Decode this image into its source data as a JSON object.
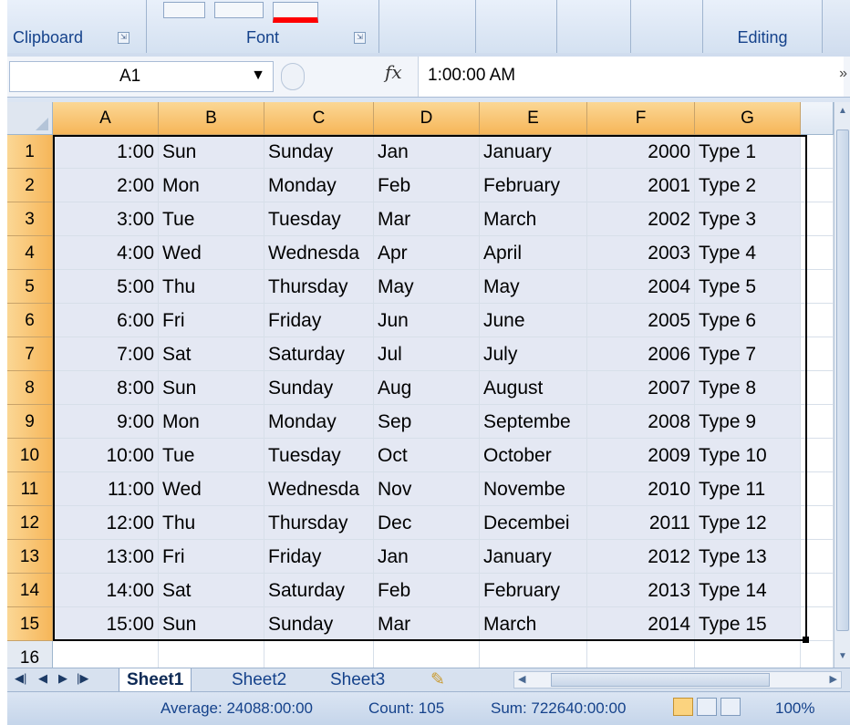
{
  "ribbon": {
    "groups": [
      {
        "label": "Clipboard",
        "launcher": "⇲"
      },
      {
        "label": "Font",
        "launcher": "⇲"
      },
      {
        "label": "Editing"
      }
    ]
  },
  "formula_bar": {
    "name_box": "A1",
    "fx": "fx",
    "content": "1:00:00 AM"
  },
  "columns": [
    "A",
    "B",
    "C",
    "D",
    "E",
    "F",
    "G"
  ],
  "rows": [
    {
      "n": "1",
      "cells": [
        "1:00",
        "Sun",
        "Sunday",
        "Jan",
        "January",
        "2000",
        "Type 1"
      ]
    },
    {
      "n": "2",
      "cells": [
        "2:00",
        "Mon",
        "Monday",
        "Feb",
        "February",
        "2001",
        "Type 2"
      ]
    },
    {
      "n": "3",
      "cells": [
        "3:00",
        "Tue",
        "Tuesday",
        "Mar",
        "March",
        "2002",
        "Type 3"
      ]
    },
    {
      "n": "4",
      "cells": [
        "4:00",
        "Wed",
        "Wednesda",
        "Apr",
        "April",
        "2003",
        "Type 4"
      ]
    },
    {
      "n": "5",
      "cells": [
        "5:00",
        "Thu",
        "Thursday",
        "May",
        "May",
        "2004",
        "Type 5"
      ]
    },
    {
      "n": "6",
      "cells": [
        "6:00",
        "Fri",
        "Friday",
        "Jun",
        "June",
        "2005",
        "Type 6"
      ]
    },
    {
      "n": "7",
      "cells": [
        "7:00",
        "Sat",
        "Saturday",
        "Jul",
        "July",
        "2006",
        "Type 7"
      ]
    },
    {
      "n": "8",
      "cells": [
        "8:00",
        "Sun",
        "Sunday",
        "Aug",
        "August",
        "2007",
        "Type 8"
      ]
    },
    {
      "n": "9",
      "cells": [
        "9:00",
        "Mon",
        "Monday",
        "Sep",
        "Septembe",
        "2008",
        "Type 9"
      ]
    },
    {
      "n": "10",
      "cells": [
        "10:00",
        "Tue",
        "Tuesday",
        "Oct",
        "October",
        "2009",
        "Type 10"
      ]
    },
    {
      "n": "11",
      "cells": [
        "11:00",
        "Wed",
        "Wednesda",
        "Nov",
        "Novembe",
        "2010",
        "Type 11"
      ]
    },
    {
      "n": "12",
      "cells": [
        "12:00",
        "Thu",
        "Thursday",
        "Dec",
        "Decembei",
        "2011",
        "Type 12"
      ]
    },
    {
      "n": "13",
      "cells": [
        "13:00",
        "Fri",
        "Friday",
        "Jan",
        "January",
        "2012",
        "Type 13"
      ]
    },
    {
      "n": "14",
      "cells": [
        "14:00",
        "Sat",
        "Saturday",
        "Feb",
        "February",
        "2013",
        "Type 14"
      ]
    },
    {
      "n": "15",
      "cells": [
        "15:00",
        "Sun",
        "Sunday",
        "Mar",
        "March",
        "2014",
        "Type 15"
      ]
    },
    {
      "n": "16",
      "cells": [
        "",
        "",
        "",
        "",
        "",
        "",
        ""
      ]
    }
  ],
  "sheet_tabs": [
    "Sheet1",
    "Sheet2",
    "Sheet3"
  ],
  "active_sheet": "Sheet1",
  "status": {
    "average": "Average: 24088:00:00",
    "count": "Count: 105",
    "sum": "Sum: 722640:00:00",
    "zoom": "100%"
  },
  "colors": {
    "header_highlight": "#f6b659",
    "selection_fill": "#e4e8f3",
    "ribbon_text": "#15428b"
  }
}
